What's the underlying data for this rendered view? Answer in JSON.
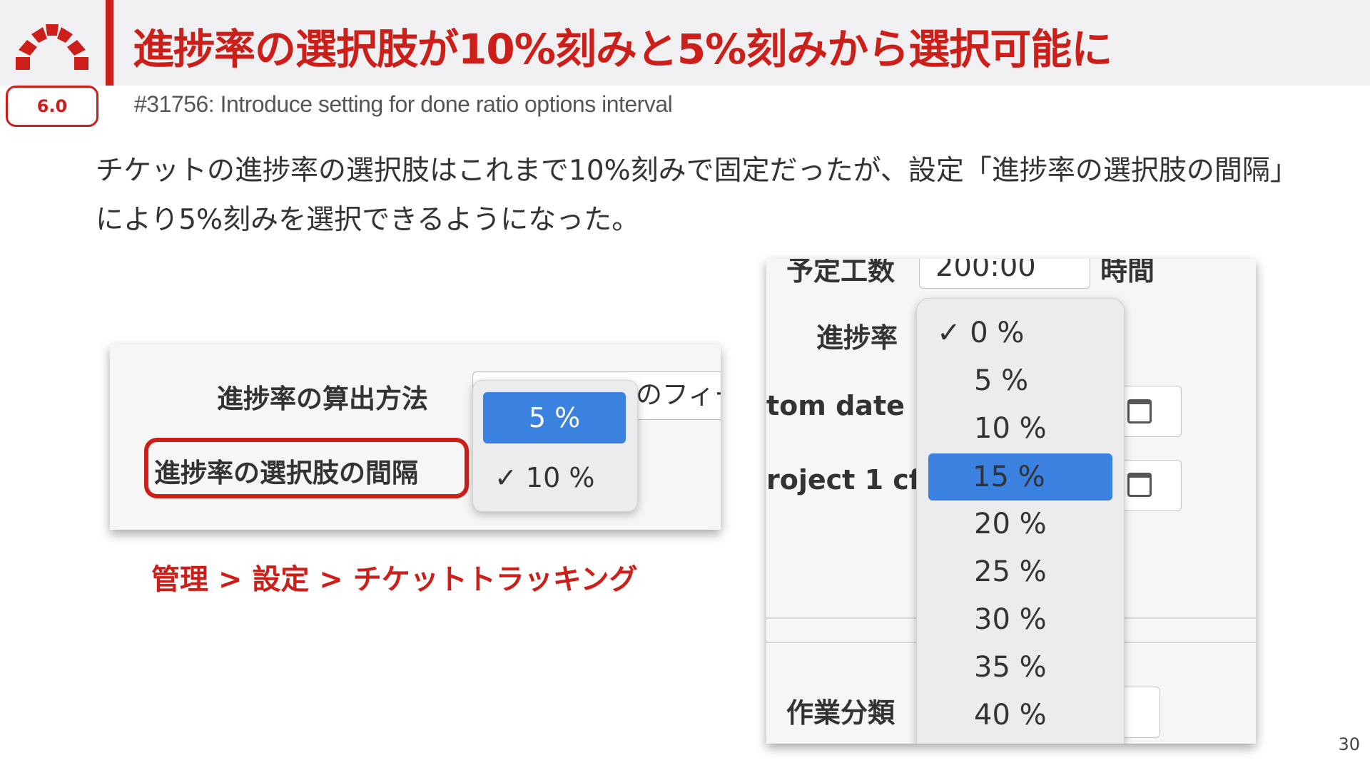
{
  "header": {
    "title": "進捗率の選択肢が10%刻みと5%刻みから選択可能に",
    "version_badge": "6.0",
    "subtitle": "#31756: Introduce setting for done ratio options interval"
  },
  "body_text": "チケットの進捗率の選択肢はこれまで10%刻みで固定だったが、設定「進捗率の選択肢の間隔」により5%刻みを選択できるようになった。",
  "settings_panel": {
    "calc_method_label": "進捗率の算出方法",
    "calc_method_value_partial": "のフィー",
    "interval_label": "進捗率の選択肢の間隔",
    "dropdown_options": [
      {
        "label": "5 %",
        "highlighted": true,
        "checked": false
      },
      {
        "label": "✓ 10 %",
        "highlighted": false,
        "checked": true
      }
    ]
  },
  "caption": "管理 > 設定 > チケットトラッキング",
  "issue_form": {
    "estimated_hours_label": "予定工数",
    "estimated_hours_value": "200:00",
    "hours_unit": "時間",
    "done_ratio_label": "進捗率",
    "custom_date_label": "tom date",
    "project_cf_label": "roject 1 cf",
    "activity_label": "作業分類",
    "done_ratio_options": [
      {
        "label": "✓ 0 %",
        "checked": true,
        "highlighted": false
      },
      {
        "label": "5 %",
        "checked": false,
        "highlighted": false
      },
      {
        "label": "10 %",
        "checked": false,
        "highlighted": false
      },
      {
        "label": "15 %",
        "checked": false,
        "highlighted": true
      },
      {
        "label": "20 %",
        "checked": false,
        "highlighted": false
      },
      {
        "label": "25 %",
        "checked": false,
        "highlighted": false
      },
      {
        "label": "30 %",
        "checked": false,
        "highlighted": false
      },
      {
        "label": "35 %",
        "checked": false,
        "highlighted": false
      },
      {
        "label": "40 %",
        "checked": false,
        "highlighted": false
      }
    ]
  },
  "page_number": "30",
  "colors": {
    "accent": "#cc1f1a",
    "selection": "#3b82e0"
  }
}
